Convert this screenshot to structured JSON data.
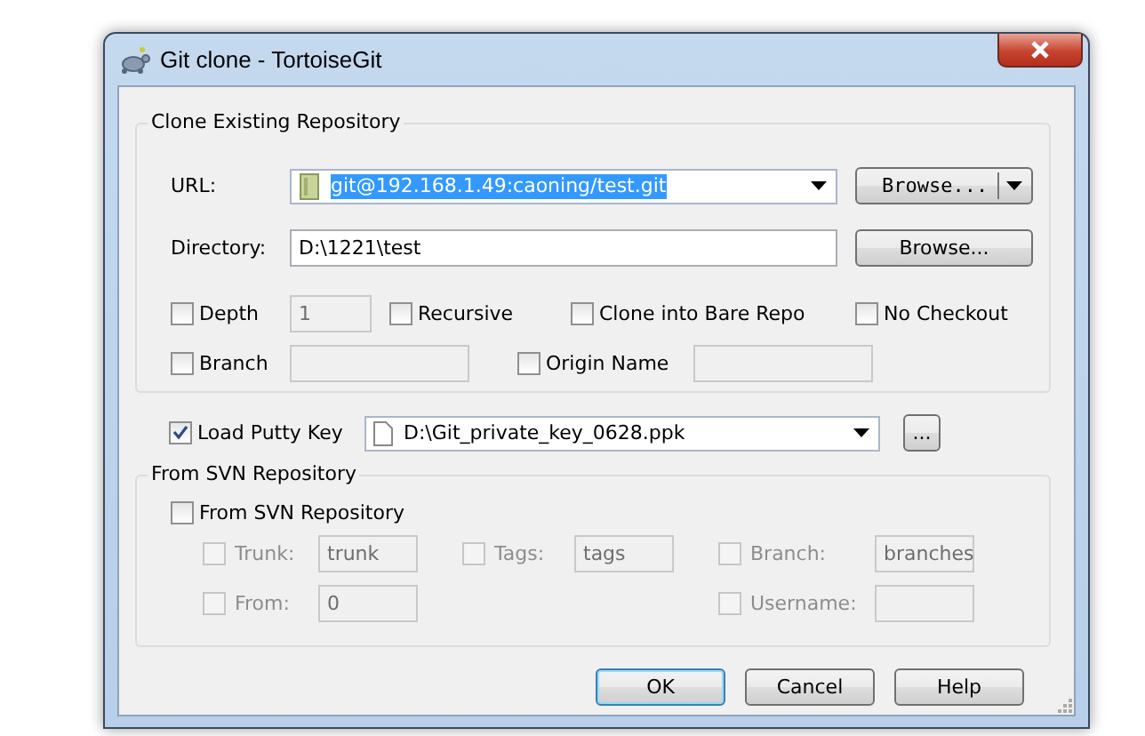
{
  "window": {
    "title": "Git clone - TortoiseGit"
  },
  "clone_group": {
    "title": "Clone Existing Repository",
    "url": {
      "label": "URL:",
      "value": "git@192.168.1.49:caoning/test.git",
      "selected": true,
      "button": "Browse..."
    },
    "directory": {
      "label": "Directory:",
      "value": "D:\\1221\\test",
      "button": "Browse..."
    },
    "option_rows": [
      [
        {
          "kind": "checkbox",
          "label": "Depth",
          "checked": false,
          "disabled": false
        },
        {
          "kind": "field",
          "value": "1",
          "disabled": true
        },
        {
          "kind": "checkbox",
          "label": "Recursive",
          "checked": false,
          "disabled": false
        },
        {
          "kind": "checkbox",
          "label": "Clone into Bare Repo",
          "checked": false,
          "disabled": false
        },
        {
          "kind": "checkbox",
          "label": "No Checkout",
          "checked": false,
          "disabled": false
        }
      ],
      [
        {
          "kind": "checkbox",
          "label": "Branch",
          "checked": false,
          "disabled": false
        },
        {
          "kind": "field",
          "disabled": true
        },
        {
          "kind": "checkbox",
          "label": "Origin Name",
          "checked": false,
          "disabled": false
        },
        {
          "kind": "field",
          "disabled": true
        }
      ]
    ]
  },
  "putty_key": {
    "label": "Load Putty Key",
    "checked": true,
    "value": "D:\\Git_private_key_0628.ppk",
    "button": "..."
  },
  "svn_group": {
    "title": "From SVN Repository",
    "checkbox": {
      "label": "From SVN Repository",
      "checked": false
    },
    "rows": [
      [
        {
          "kind": "checkbox",
          "label": "Trunk:",
          "checked": false,
          "disabled": true
        },
        {
          "kind": "field",
          "value": "trunk",
          "disabled": true
        },
        {
          "kind": "checkbox",
          "label": "Tags:",
          "checked": false,
          "disabled": true
        },
        {
          "kind": "field",
          "value": "tags",
          "disabled": true
        },
        {
          "kind": "checkbox",
          "label": "Branch:",
          "checked": false,
          "disabled": true
        },
        {
          "kind": "field",
          "value": "branches",
          "disabled": true
        }
      ],
      [
        {
          "kind": "checkbox",
          "label": "From:",
          "checked": false,
          "disabled": true
        },
        {
          "kind": "field",
          "value": "0",
          "disabled": true
        },
        "",
        "",
        {
          "kind": "checkbox",
          "label": "Username:",
          "checked": false,
          "disabled": true
        },
        {
          "kind": "field",
          "disabled": true
        }
      ]
    ]
  },
  "buttons": [
    {
      "label": "OK",
      "default": true
    },
    {
      "label": "Cancel",
      "default": false
    },
    {
      "label": "Help",
      "default": false
    }
  ]
}
